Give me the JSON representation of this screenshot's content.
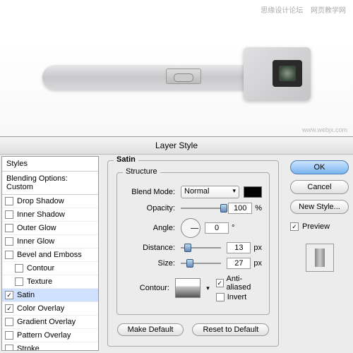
{
  "watermark": {
    "left": "思缘设计论坛",
    "right": "网页教学网",
    "url": "www.webjx.com"
  },
  "dialog": {
    "title": "Layer Style",
    "styles_header": "Styles",
    "blending_options": "Blending Options: Custom",
    "items": [
      {
        "label": "Drop Shadow",
        "checked": false
      },
      {
        "label": "Inner Shadow",
        "checked": false
      },
      {
        "label": "Outer Glow",
        "checked": false
      },
      {
        "label": "Inner Glow",
        "checked": false
      },
      {
        "label": "Bevel and Emboss",
        "checked": false
      },
      {
        "label": "Contour",
        "checked": false,
        "indent": true
      },
      {
        "label": "Texture",
        "checked": false,
        "indent": true
      },
      {
        "label": "Satin",
        "checked": true,
        "selected": true
      },
      {
        "label": "Color Overlay",
        "checked": true
      },
      {
        "label": "Gradient Overlay",
        "checked": false
      },
      {
        "label": "Pattern Overlay",
        "checked": false
      },
      {
        "label": "Stroke",
        "checked": false
      }
    ]
  },
  "satin": {
    "legend": "Satin",
    "structure": "Structure",
    "blend_mode_label": "Blend Mode:",
    "blend_mode_value": "Normal",
    "opacity_label": "Opacity:",
    "opacity_value": "100",
    "opacity_unit": "%",
    "angle_label": "Angle:",
    "angle_value": "0",
    "angle_unit": "°",
    "distance_label": "Distance:",
    "distance_value": "13",
    "distance_unit": "px",
    "size_label": "Size:",
    "size_value": "27",
    "size_unit": "px",
    "contour_label": "Contour:",
    "anti_aliased": "Anti-aliased",
    "invert": "Invert",
    "make_default": "Make Default",
    "reset_default": "Reset to Default"
  },
  "buttons": {
    "ok": "OK",
    "cancel": "Cancel",
    "new_style": "New Style...",
    "preview": "Preview"
  }
}
